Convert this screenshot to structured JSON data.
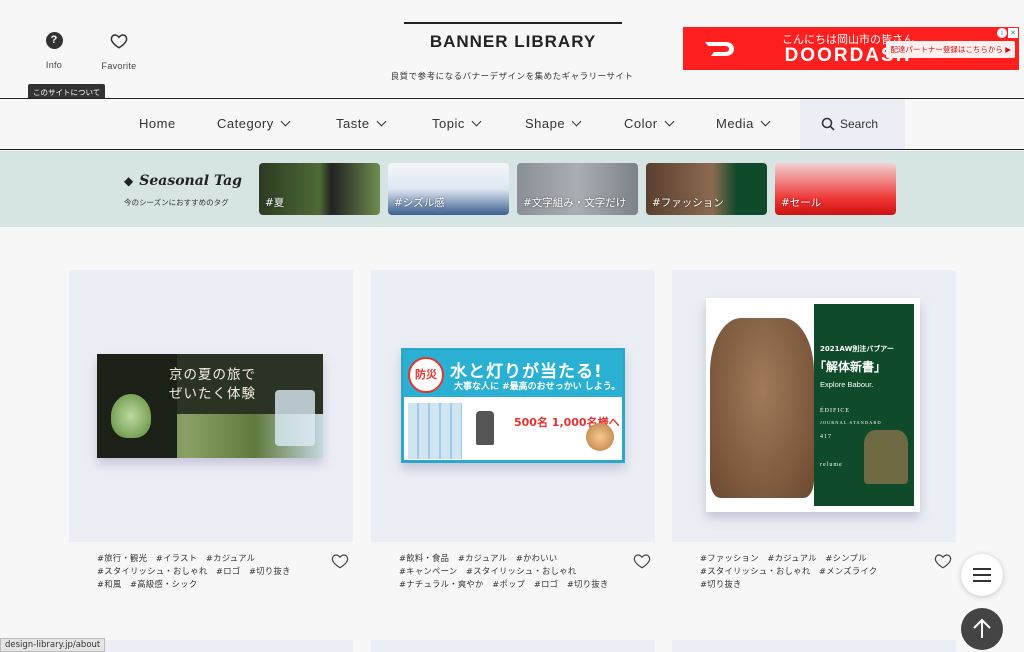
{
  "header": {
    "info_label": "Info",
    "favorite_label": "Favorite",
    "tooltip": "このサイトについて",
    "logo": "BANNER LIBRARY",
    "tagline": "良質で参考になるバナーデザインを集めたギャラリーサイト"
  },
  "ad": {
    "top_text": "こんにちは岡山市の皆さん",
    "brand": "DOORDASH",
    "cta": "配達パートナー登録はこちらから ▶",
    "brand_color": "#ff1f1f"
  },
  "nav": {
    "items": [
      {
        "label": "Home"
      },
      {
        "label": "Category"
      },
      {
        "label": "Taste"
      },
      {
        "label": "Topic"
      },
      {
        "label": "Shape"
      },
      {
        "label": "Color"
      },
      {
        "label": "Media"
      }
    ],
    "search_label": "Search"
  },
  "seasonal": {
    "title": "Seasonal Tag",
    "subtitle": "今のシーズンにおすすめのタグ",
    "tags": [
      {
        "label": "#夏"
      },
      {
        "label": "#シズル感"
      },
      {
        "label": "#文字組み・文字だけ"
      },
      {
        "label": "#ファッション"
      },
      {
        "label": "#セール"
      }
    ]
  },
  "cards": [
    {
      "banner_text_1": "京の夏の旅で",
      "banner_text_2": "ぜいたく体験",
      "tags_line1": "#旅行・観光　#イラスト　#カジュアル",
      "tags_line2": "#スタイリッシュ・おしゃれ　#ロゴ　#切り抜き",
      "tags_line3": "#和風　#高級感・シック"
    },
    {
      "seal": "防災",
      "headline": "水と灯りが当たる!",
      "subline": "大事な人に #最高のおせっかい しよう。",
      "prize": "500名 1,000名様へ",
      "tags_line1": "#飲料・食品　#カジュアル　#かわいい",
      "tags_line2": "#キャンペーン　#スタイリッシュ・おしゃれ",
      "tags_line3": "#ナチュラル・爽やか　#ポップ　#ロゴ　#切り抜き"
    },
    {
      "title1": "2021AW別注バブアー",
      "title2": "「解体新書」",
      "title3": "Explore Babour.",
      "brand1": "ÉDIFICE",
      "brand2": "JOURNAL STANDARD",
      "brand3": "417",
      "brand4": "relume",
      "tags_line1": "#ファッション　#カジュアル　#シンプル",
      "tags_line2": "#スタイリッシュ・おしゃれ　#メンズライク",
      "tags_line3": "#切り抜き"
    }
  ],
  "status_url": "design-library.jp/about",
  "icons": {
    "info": "question-circle-icon",
    "favorite": "heart-icon",
    "search": "magnifier-icon",
    "menu": "hamburger-icon",
    "to_top": "arrow-up-icon"
  }
}
